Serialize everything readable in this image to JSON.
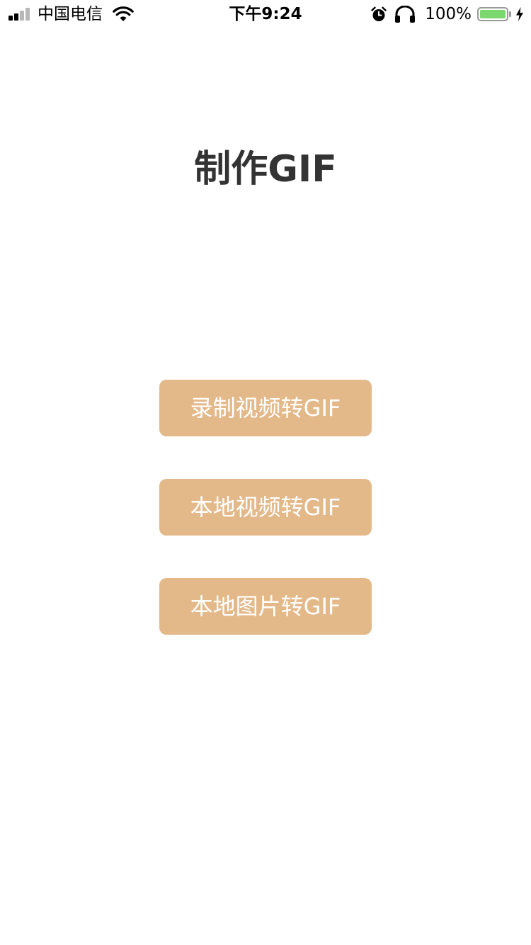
{
  "status_bar": {
    "carrier": "中国电信",
    "time": "下午9:24",
    "battery_percent_label": "100%",
    "battery_level": 1.0,
    "icons": [
      "signal-icon",
      "wifi-icon",
      "alarm-icon",
      "headphones-icon",
      "battery-icon",
      "charging-bolt-icon"
    ]
  },
  "main": {
    "title": "制作GIF",
    "buttons": [
      {
        "label": "录制视频转GIF"
      },
      {
        "label": "本地视频转GIF"
      },
      {
        "label": "本地图片转GIF"
      }
    ]
  },
  "colors": {
    "background": "#ffffff",
    "title_text": "#333333",
    "button_bg": "#e4b98a",
    "button_text": "#ffffff",
    "battery_fill": "#7bd86e"
  }
}
